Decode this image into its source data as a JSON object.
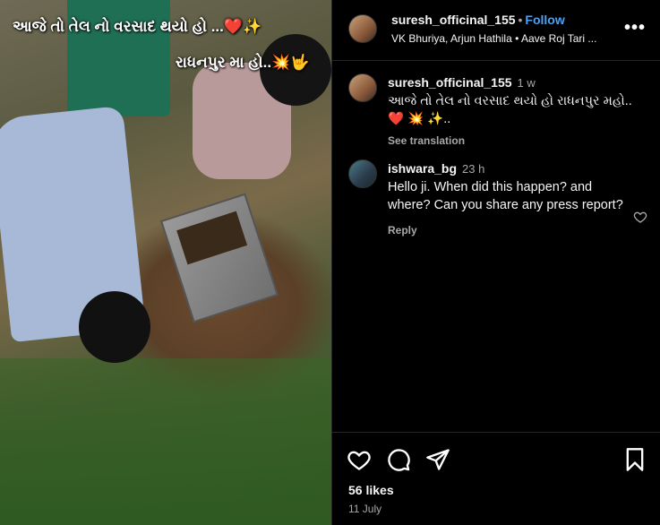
{
  "media": {
    "caption_line1": "આજે તો તેલ નો વરસાદ થયો હો ...❤️✨",
    "caption_line2": "રાધનપુર મા હો..💥🤟"
  },
  "header": {
    "username": "suresh_officinal_155",
    "follow_label": "Follow",
    "audio": "VK Bhuriya, Arjun Hathila • Aave Roj Tari ...",
    "more_icon": "more-icon"
  },
  "comments": [
    {
      "username": "suresh_officinal_155",
      "ago": "1 w",
      "text": "આજે તો તેલ નો વરસાદ થયો હો રાધનપુર મહો..❤️ 💥 ✨..",
      "sub": "See translation"
    },
    {
      "username": "ishwara_bg",
      "ago": "23 h",
      "text": "Hello ji. When did this happen? and where? Can you share any press report?",
      "sub": "Reply"
    }
  ],
  "actions": {
    "icons": [
      "heart-icon",
      "comment-icon",
      "share-icon",
      "bookmark-icon"
    ]
  },
  "likes": "56 likes",
  "date": "11 July"
}
